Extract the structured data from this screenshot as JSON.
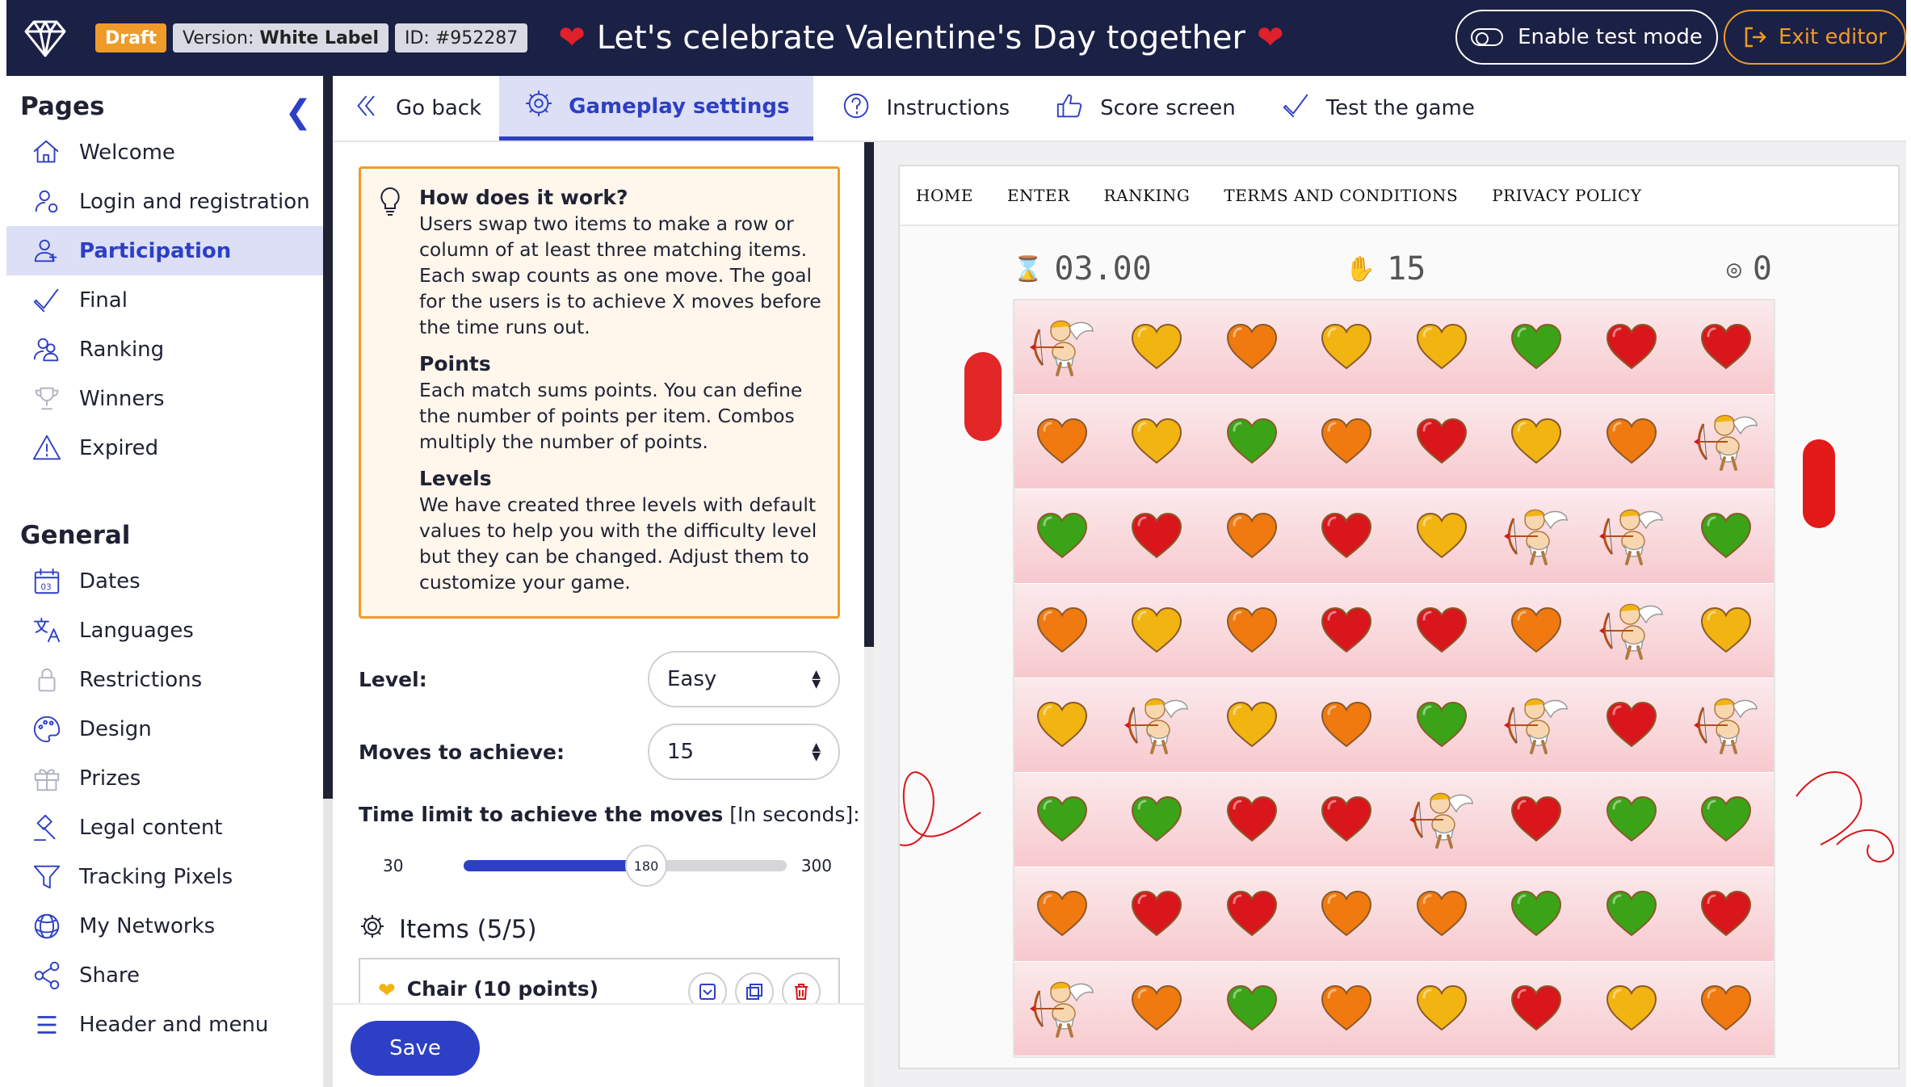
{
  "topbar": {
    "draft": "Draft",
    "version_label": "Version:",
    "version_value": "White Label",
    "id": "ID: #952287",
    "title": "Let's celebrate Valentine's Day together",
    "test_mode": "Enable test mode",
    "exit": "Exit editor"
  },
  "sidebar": {
    "pages_title": "Pages",
    "pages": [
      {
        "label": "Welcome",
        "icon": "home-icon"
      },
      {
        "label": "Login and registration",
        "icon": "user-login-icon"
      },
      {
        "label": "Participation",
        "icon": "user-add-icon",
        "active": true
      },
      {
        "label": "Final",
        "icon": "check-icon"
      },
      {
        "label": "Ranking",
        "icon": "users-icon"
      },
      {
        "label": "Winners",
        "icon": "trophy-icon"
      },
      {
        "label": "Expired",
        "icon": "warning-icon"
      }
    ],
    "general_title": "General",
    "general": [
      {
        "label": "Dates",
        "icon": "calendar-icon"
      },
      {
        "label": "Languages",
        "icon": "translate-icon"
      },
      {
        "label": "Restrictions",
        "icon": "lock-icon"
      },
      {
        "label": "Design",
        "icon": "palette-icon"
      },
      {
        "label": "Prizes",
        "icon": "gift-icon"
      },
      {
        "label": "Legal content",
        "icon": "gavel-icon"
      },
      {
        "label": "Tracking Pixels",
        "icon": "filter-icon"
      },
      {
        "label": "My Networks",
        "icon": "network-icon"
      },
      {
        "label": "Share",
        "icon": "share-icon"
      },
      {
        "label": "Header and menu",
        "icon": "menu-icon"
      }
    ]
  },
  "tabs": [
    {
      "label": "Go back",
      "icon": "double-chevron-left-icon"
    },
    {
      "label": "Gameplay settings",
      "icon": "gear-icon",
      "active": true
    },
    {
      "label": "Instructions",
      "icon": "question-icon"
    },
    {
      "label": "Score screen",
      "icon": "thumbs-up-icon"
    },
    {
      "label": "Test the game",
      "icon": "check-icon"
    }
  ],
  "info": {
    "how_title": "How does it work?",
    "how_text": "Users swap two items to make a row or column of at least three matching items. Each swap counts as one move. The goal for the users is to achieve X moves before the time runs out.",
    "points_title": "Points",
    "points_text": "Each match sums points. You can define the number of points per item. Combos multiply the number of points.",
    "levels_title": "Levels",
    "levels_text": "We have created three levels with default values to help you with the difficulty level but they can be changed. Adjust them to customize your game."
  },
  "form": {
    "level_label": "Level:",
    "level_value": "Easy",
    "moves_label": "Moves to achieve:",
    "moves_value": "15",
    "time_label": "Time limit to achieve the moves",
    "time_unit": "[In seconds]:",
    "time_min": "30",
    "time_max": "300",
    "time_value": "180",
    "items_title": "Items (5/5)",
    "item1": "Chair (10 points)",
    "save": "Save"
  },
  "preview": {
    "nav": [
      "HOME",
      "ENTER",
      "RANKING",
      "TERMS AND CONDITIONS",
      "PRIVACY POLICY"
    ],
    "timer": "03.00",
    "moves": "15",
    "score": "0",
    "board": [
      [
        "cupid",
        "yellow",
        "orange",
        "yellow",
        "yellow",
        "green",
        "red",
        "red"
      ],
      [
        "orange",
        "yellow",
        "green",
        "orange",
        "red",
        "yellow",
        "orange",
        "cupid"
      ],
      [
        "green",
        "red",
        "orange",
        "red",
        "yellow",
        "cupid",
        "cupid",
        "green"
      ],
      [
        "orange",
        "yellow",
        "orange",
        "red",
        "red",
        "orange",
        "cupid",
        "yellow"
      ],
      [
        "yellow",
        "cupid",
        "yellow",
        "orange",
        "green",
        "cupid",
        "red",
        "cupid"
      ],
      [
        "green",
        "green",
        "red",
        "red",
        "cupid",
        "red",
        "green",
        "green"
      ],
      [
        "orange",
        "red",
        "red",
        "orange",
        "orange",
        "green",
        "green",
        "red"
      ],
      [
        "cupid",
        "orange",
        "green",
        "orange",
        "yellow",
        "red",
        "yellow",
        "orange"
      ]
    ],
    "colors": {
      "red": "#d9161c",
      "orange": "#f07a10",
      "yellow": "#f2b411",
      "green": "#3aa317"
    }
  },
  "colors": {
    "accent": "#2d3fc5",
    "topbar": "#1b2045",
    "warning": "#ef9b2a"
  }
}
